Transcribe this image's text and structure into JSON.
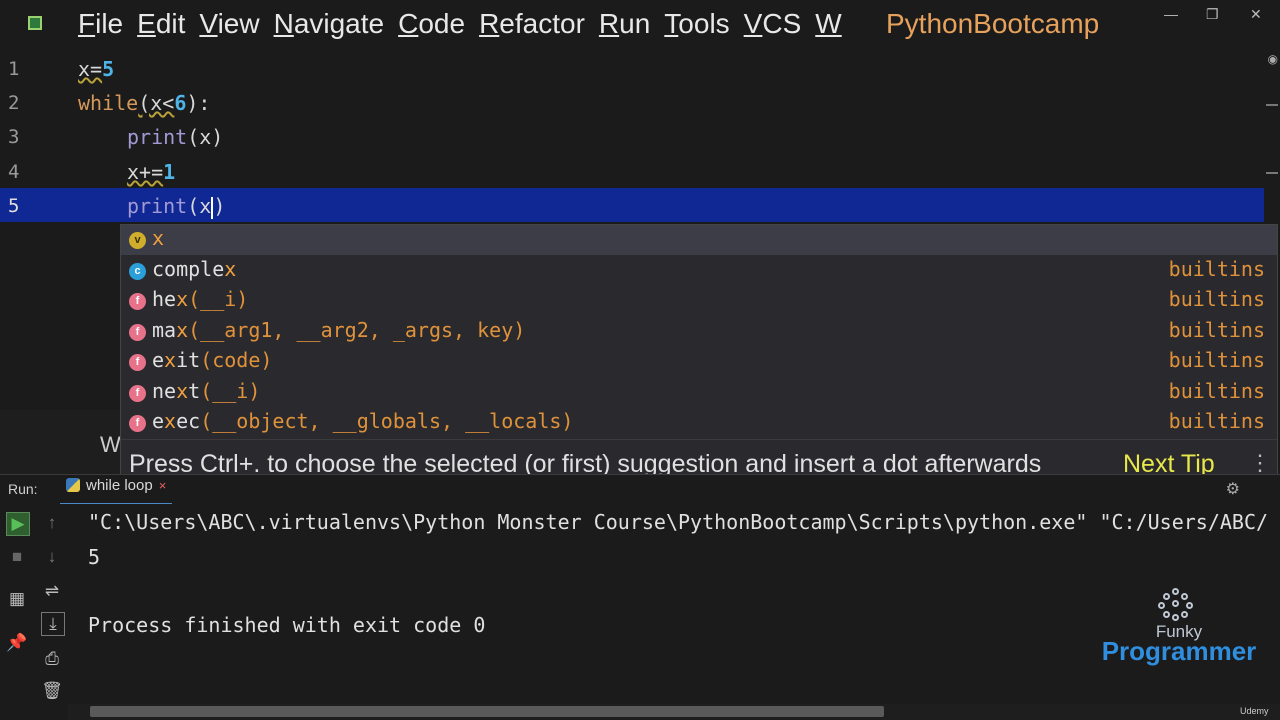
{
  "menubar": {
    "items": [
      "File",
      "Edit",
      "View",
      "Navigate",
      "Code",
      "Refactor",
      "Run",
      "Tools",
      "VCS",
      "W"
    ],
    "project_title": "PythonBootcamp",
    "window_controls": [
      "—",
      "❐",
      "✕"
    ]
  },
  "editor": {
    "line_numbers": [
      "1",
      "2",
      "3",
      "4",
      "5"
    ],
    "lines": [
      {
        "a": "x=",
        "b": "5"
      },
      {
        "kw": "while",
        "a": "(x<",
        "b": "6",
        "c": "):"
      },
      {
        "fn": "print",
        "a": "(x)"
      },
      {
        "a": "x+=",
        "b": "1"
      },
      {
        "fn": "print",
        "a": "(x"
      }
    ]
  },
  "autocomplete": {
    "items": [
      {
        "badge": "v",
        "match": "x",
        "rest": "",
        "params": "",
        "source": ""
      },
      {
        "badge": "c",
        "match": "comple",
        "hl": "x",
        "params": "",
        "source": "builtins"
      },
      {
        "badge": "f",
        "match": "he",
        "hl": "x",
        "params": "(__i)",
        "source": "builtins"
      },
      {
        "badge": "f",
        "match": "ma",
        "hl": "x",
        "params": "(__arg1, __arg2, _args, key)",
        "source": "builtins"
      },
      {
        "badge": "f",
        "match": "e",
        "hl": "x",
        "rest": "it",
        "params": "(code)",
        "source": "builtins"
      },
      {
        "badge": "f",
        "match": "ne",
        "hl": "x",
        "rest": "t",
        "params": "(__i)",
        "source": "builtins"
      },
      {
        "badge": "f",
        "match": "e",
        "hl": "x",
        "rest": "ec",
        "params": "(__object, __globals, __locals)",
        "source": "builtins"
      }
    ],
    "tip_text": "Press Ctrl+. to choose the selected (or first) suggestion and insert a dot afterwards",
    "next_tip": "Next Tip",
    "more": "⋮"
  },
  "hidden_fragment": "W",
  "run": {
    "label": "Run:",
    "tab": "while loop",
    "tab_close": "×"
  },
  "console": {
    "lines": [
      "\"C:\\Users\\ABC\\.virtualenvs\\Python Monster Course\\PythonBootcamp\\Scripts\\python.exe\" \"C:/Users/ABC/",
      "5",
      "",
      "Process finished with exit code 0"
    ]
  },
  "logo": {
    "top": "Funky",
    "bottom": "Programmer"
  },
  "watermark": "Udemy"
}
